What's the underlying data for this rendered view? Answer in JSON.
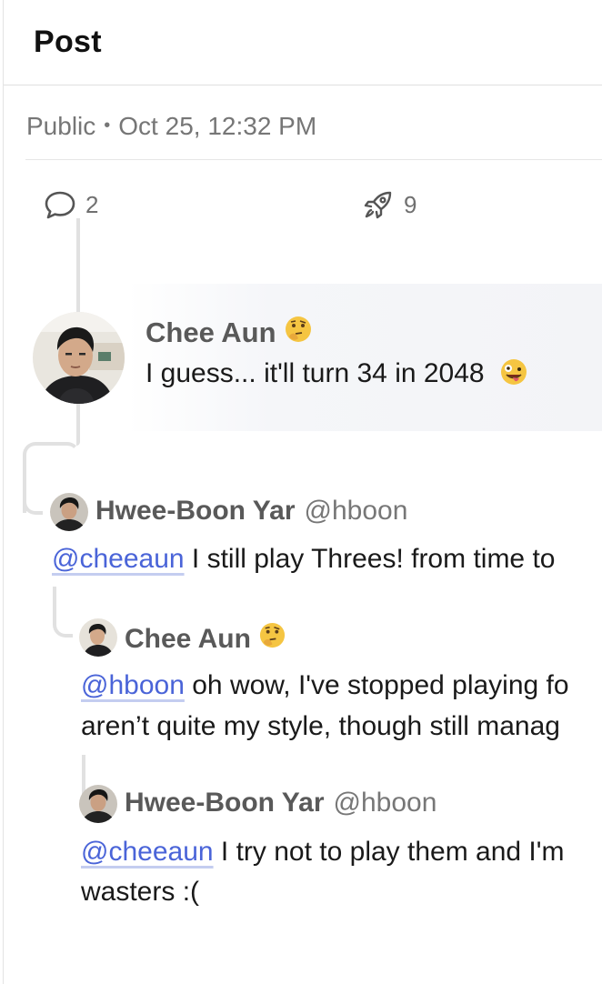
{
  "header": {
    "title": "Post"
  },
  "meta": {
    "visibility": "Public",
    "separator": "•",
    "timestamp": "Oct 25, 12:32 PM"
  },
  "stats": {
    "replies_count": "2",
    "boosts_count": "9"
  },
  "thread": {
    "parent": {
      "author_name": "Chee Aun",
      "content": "I guess... it'll turn 34 in 2048"
    },
    "reply1": {
      "author_name": "Hwee-Boon Yar",
      "author_handle": "@hboon",
      "mention": "@cheeaun",
      "content": "I still play Threes! from time to"
    },
    "reply2": {
      "author_name": "Chee Aun",
      "mention": "@hboon",
      "content_line1": "oh wow, I've stopped playing fo",
      "content_line2": "aren’t quite my style, though still manag"
    },
    "reply3": {
      "author_name": "Hwee-Boon Yar",
      "author_handle": "@hboon",
      "mention": "@cheeaun",
      "content_line1": "I try not to play them and I'm",
      "content_line2": "wasters :("
    }
  },
  "colors": {
    "mention": "#4a64d8",
    "text": "#1a1a1a",
    "muted": "#767676",
    "thread_line": "#e1e1e1"
  },
  "icons": {
    "reply": "speech-bubble-icon",
    "boost": "rocket-icon",
    "thinking": "thinking-face-emoji",
    "zany": "zany-face-emoji"
  }
}
